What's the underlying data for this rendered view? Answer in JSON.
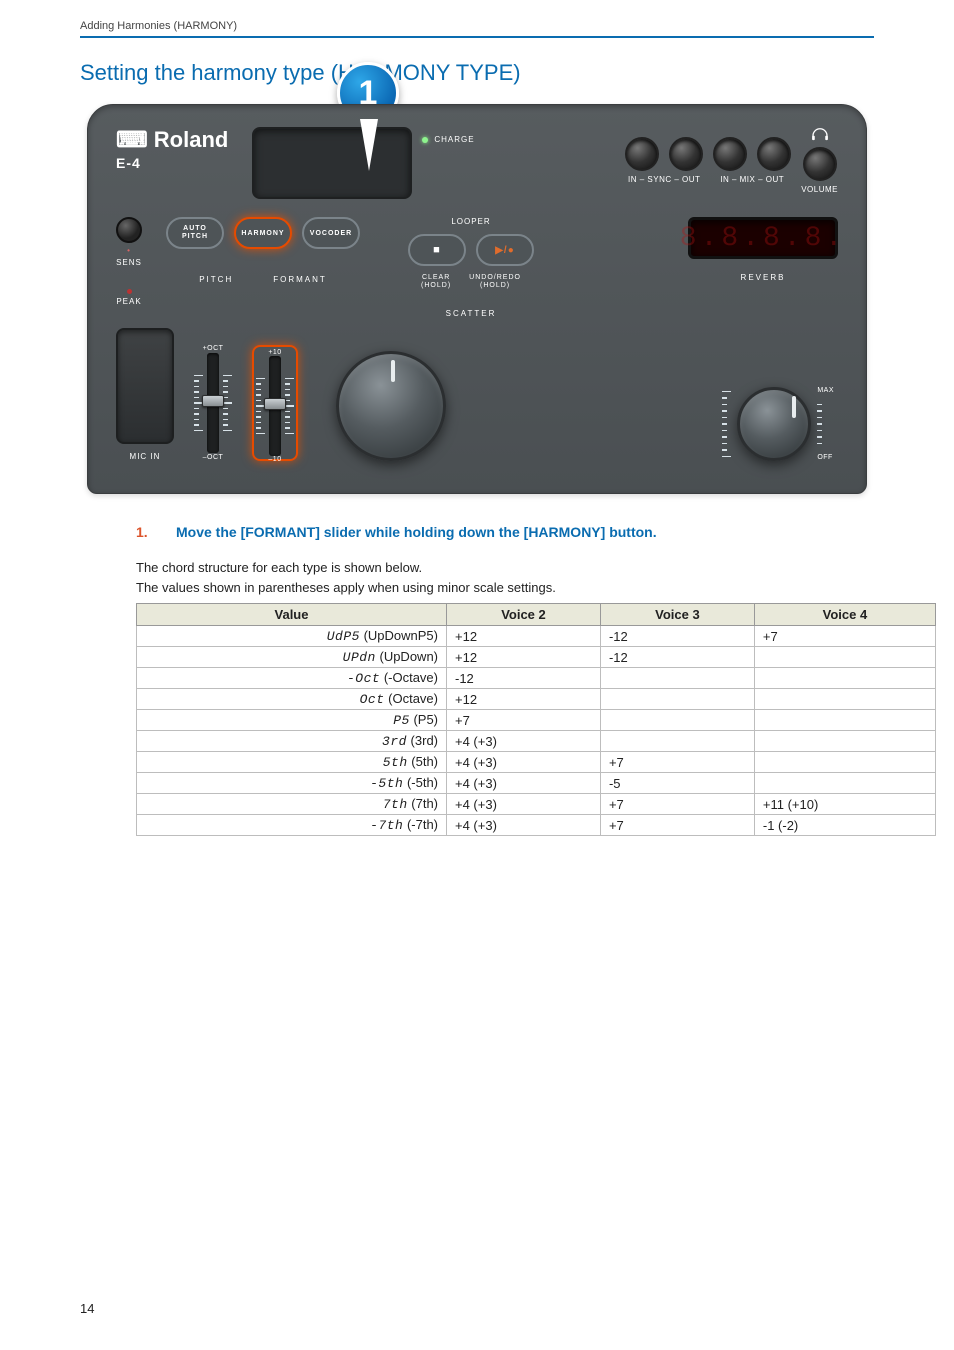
{
  "header": {
    "breadcrumb": "Adding Harmonies (HARMONY)"
  },
  "section_title": "Setting the harmony type (HARMONY TYPE)",
  "callout": {
    "number": "1"
  },
  "device": {
    "brand": "Roland",
    "model": "E-4",
    "charge_label": "CHARGE",
    "jacks": {
      "sync": {
        "label": "IN – SYNC – OUT"
      },
      "mix": {
        "label": "IN – MIX – OUT"
      },
      "volume_label": "VOLUME"
    },
    "sens": {
      "label": "SENS",
      "peak_label": "PEAK"
    },
    "mode_buttons": {
      "auto_pitch": "AUTO\nPITCH",
      "harmony": "HARMONY",
      "vocoder": "VOCODER"
    },
    "slider_labels": {
      "pitch": "PITCH",
      "formant": "FORMANT"
    },
    "looper": {
      "title": "LOOPER",
      "stop_icon": "■",
      "playrec_icon": "▶/●",
      "clear_label": "CLEAR\n(HOLD)",
      "undo_label": "UNDO/REDO\n(HOLD)",
      "scatter_label": "SCATTER"
    },
    "display7seg": "8.8.8.8.",
    "reverb_label": "REVERB",
    "pad_label": "MIC IN",
    "pitch_slider": {
      "top": "+OCT",
      "bottom": "–OCT"
    },
    "formant_slider": {
      "top": "+10",
      "bottom": "–10"
    },
    "reverb_knob": {
      "max": "MAX",
      "off": "OFF"
    }
  },
  "step": {
    "num": "1.",
    "text": "Move the [FORMANT] slider while holding down the [HARMONY] button."
  },
  "body": {
    "line1": "The chord structure for each type is shown below.",
    "line2": "The values shown in parentheses apply when using minor scale settings."
  },
  "table": {
    "headers": {
      "value": "Value",
      "v2": "Voice 2",
      "v3": "Voice 3",
      "v4": "Voice 4"
    },
    "rows": [
      {
        "seg": "UdP5",
        "name": " (UpDownP5)",
        "v2": "+12",
        "v3": "-12",
        "v4": "+7"
      },
      {
        "seg": "UPdn",
        "name": " (UpDown)",
        "v2": "+12",
        "v3": "-12",
        "v4": ""
      },
      {
        "seg": "-Oct",
        "name": " (-Octave)",
        "v2": "-12",
        "v3": "",
        "v4": ""
      },
      {
        "seg": "Oct",
        "name": " (Octave)",
        "v2": "+12",
        "v3": "",
        "v4": ""
      },
      {
        "seg": "P5",
        "name": " (P5)",
        "v2": "+7",
        "v3": "",
        "v4": ""
      },
      {
        "seg": "3rd",
        "name": " (3rd)",
        "v2": "+4 (+3)",
        "v3": "",
        "v4": ""
      },
      {
        "seg": "5th",
        "name": " (5th)",
        "v2": "+4 (+3)",
        "v3": "+7",
        "v4": ""
      },
      {
        "seg": "-5th",
        "name": " (-5th)",
        "v2": "+4 (+3)",
        "v3": "-5",
        "v4": ""
      },
      {
        "seg": "7th",
        "name": " (7th)",
        "v2": "+4 (+3)",
        "v3": "+7",
        "v4": "+11 (+10)"
      },
      {
        "seg": "-7th",
        "name": " (-7th)",
        "v2": "+4 (+3)",
        "v3": "+7",
        "v4": "-1 (-2)"
      }
    ]
  },
  "page_number": "14"
}
